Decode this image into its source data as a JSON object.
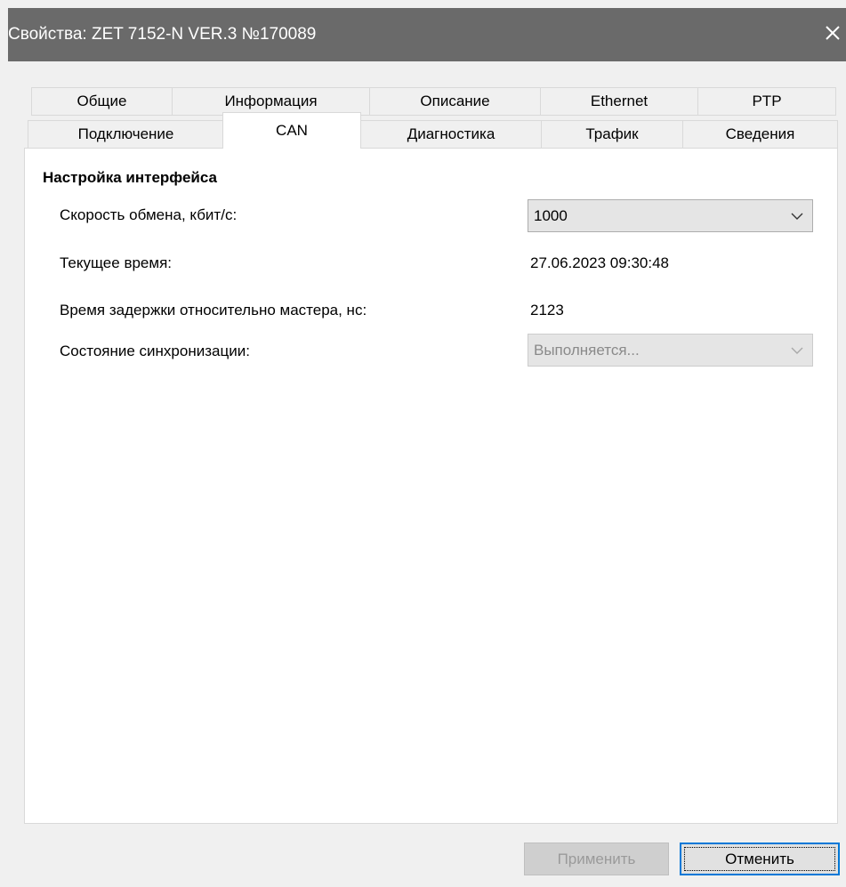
{
  "window": {
    "title": "Свойства: ZET 7152-N VER.3 №170089"
  },
  "tabs": {
    "row1": [
      "Общие",
      "Информация",
      "Описание",
      "Ethernet",
      "PTP"
    ],
    "row2": [
      "Подключение",
      "CAN",
      "Диагностика",
      "Трафик",
      "Сведения"
    ],
    "active": "CAN"
  },
  "panel": {
    "section_title": "Настройка интерфейса",
    "rows": [
      {
        "label": "Скорость обмена, кбит/с:",
        "value": "1000",
        "control": "combobox"
      },
      {
        "label": "Текущее время:",
        "value": "27.06.2023 09:30:48",
        "control": "text"
      },
      {
        "label": "Время задержки относительно мастера, нс:",
        "value": "2123",
        "control": "text"
      },
      {
        "label": "Состояние синхронизации:",
        "value": "Выполняется...",
        "control": "combobox-disabled"
      }
    ]
  },
  "buttons": {
    "apply": "Применить",
    "cancel": "Отменить"
  },
  "icons": {
    "close": "close-icon",
    "dropdown": "chevron-down-icon"
  },
  "colors": {
    "titlebar": "#6a6a6a",
    "focus_border": "#0078d7"
  }
}
